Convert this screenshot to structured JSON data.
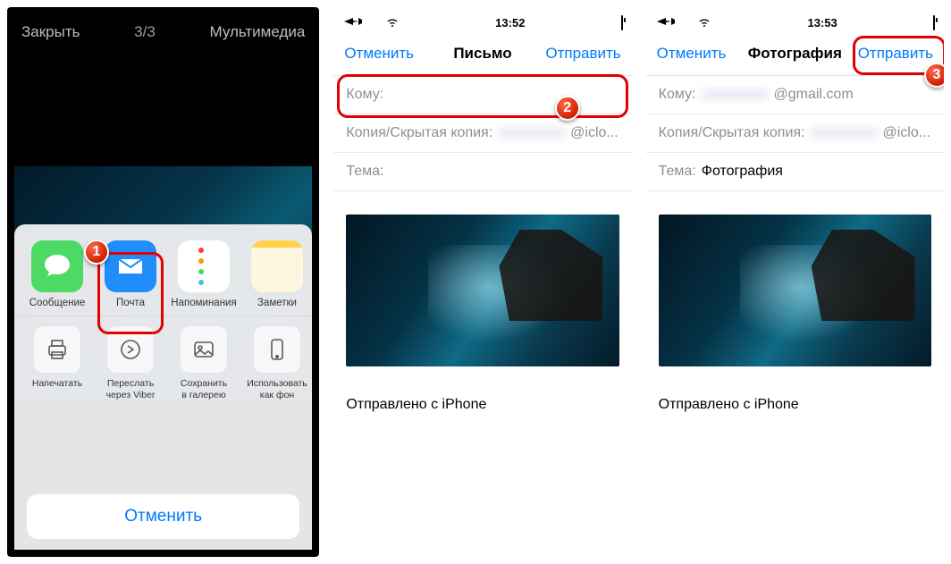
{
  "badges": {
    "b1": "1",
    "b2": "2",
    "b3": "3"
  },
  "screen1": {
    "close": "Закрыть",
    "counter": "3/3",
    "multimedia": "Мультимедиа",
    "apps": {
      "messages": "Сообщение",
      "mail": "Почта",
      "reminders": "Напоминания",
      "notes": "Заметки"
    },
    "actions": {
      "print": "Напечатать",
      "forward_viber": "Переслать\nчерез Viber",
      "save_gallery": "Сохранить\nв галерею",
      "use_wallpaper": "Использовать\nкак фон"
    },
    "cancel": "Отменить"
  },
  "screen2": {
    "time": "13:52",
    "cancel": "Отменить",
    "title": "Письмо",
    "send": "Отправить",
    "to_label": "Кому:",
    "cc_label": "Копия/Скрытая копия:",
    "cc_suffix": "@iclo...",
    "subject_label": "Тема:",
    "signature": "Отправлено с iPhone"
  },
  "screen3": {
    "time": "13:53",
    "cancel": "Отменить",
    "title": "Фотография",
    "send": "Отправить",
    "to_label": "Кому:",
    "to_suffix": "@gmail.com",
    "cc_label": "Копия/Скрытая копия:",
    "cc_suffix": "@iclo...",
    "subject_label": "Тема:",
    "subject_value": "Фотография",
    "signature": "Отправлено с iPhone"
  }
}
